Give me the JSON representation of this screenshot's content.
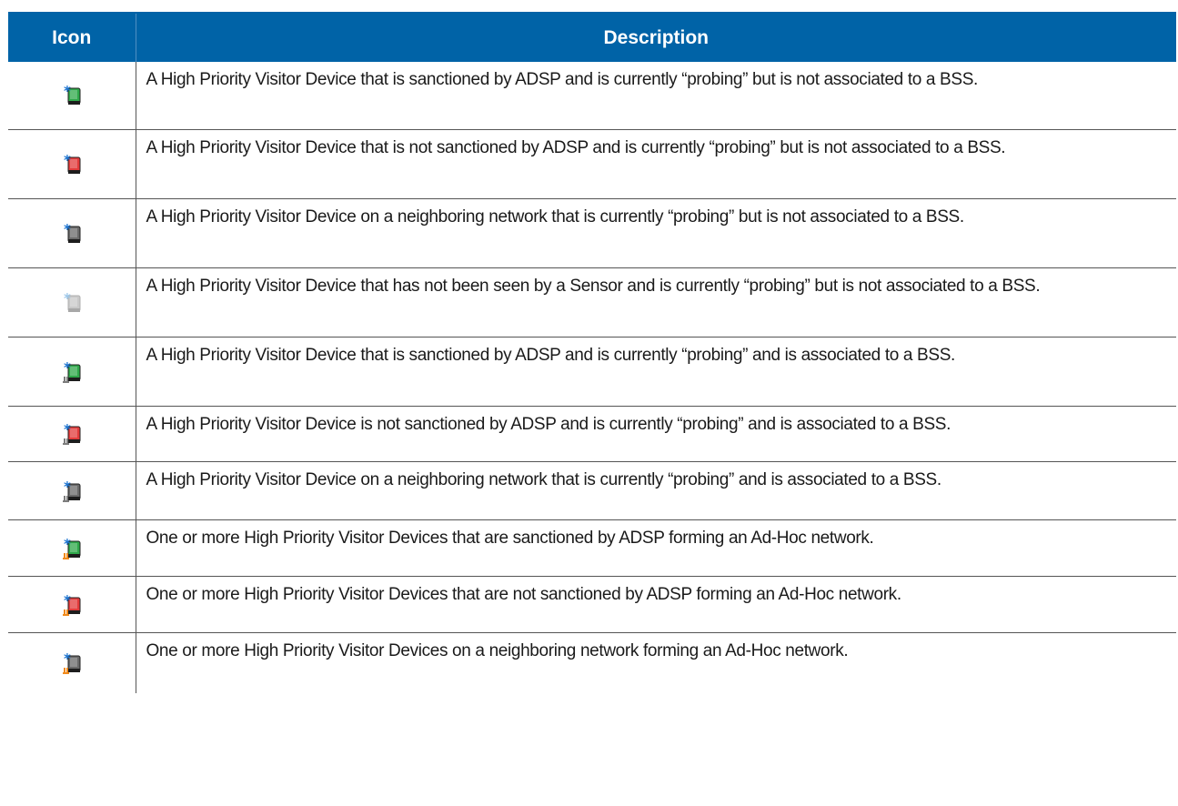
{
  "table": {
    "header": {
      "icon": "Icon",
      "description": "Description"
    },
    "rows": [
      {
        "icon": "visitor-sanctioned-probing-icon",
        "color": "#2fa84a",
        "base": "none",
        "description": "A High Priority Visitor Device that is sanctioned by ADSP and is currently “probing” but is not associated to a BSS."
      },
      {
        "icon": "visitor-unsanctioned-probing-icon",
        "color": "#e23b3b",
        "base": "none",
        "description": "A High Priority Visitor Device that is not sanctioned by ADSP and is currently “probing” but is not associated to a BSS."
      },
      {
        "icon": "visitor-neighbor-probing-icon",
        "color": "#6a6a6a",
        "base": "none",
        "description": "A High Priority Visitor Device on a neighboring network that is currently “probing” but is not associated to a BSS."
      },
      {
        "icon": "visitor-unseen-probing-icon",
        "color": "#c9c9c9",
        "base": "none",
        "description": "A High Priority Visitor Device that has not been seen by a Sensor and is currently “probing” but is not associated to a BSS."
      },
      {
        "icon": "visitor-sanctioned-associated-icon",
        "color": "#2fa84a",
        "base": "gray",
        "description": "A High Priority Visitor Device that is sanctioned by ADSP and is currently “probing” and is associated to a BSS."
      },
      {
        "icon": "visitor-unsanctioned-associated-icon",
        "color": "#e23b3b",
        "base": "gray",
        "description": "A High Priority Visitor Device is not sanctioned by ADSP and is currently “probing” and is associated to a BSS."
      },
      {
        "icon": "visitor-neighbor-associated-icon",
        "color": "#6a6a6a",
        "base": "gray",
        "description": "A High Priority Visitor Device on a neighboring network that is currently “probing” and is associated to a BSS."
      },
      {
        "icon": "visitor-sanctioned-adhoc-icon",
        "color": "#2fa84a",
        "base": "orange",
        "description": "One or more High Priority Visitor Devices that are sanctioned by ADSP forming an Ad-Hoc network."
      },
      {
        "icon": "visitor-unsanctioned-adhoc-icon",
        "color": "#e23b3b",
        "base": "orange",
        "description": "One or more High Priority Visitor Devices that are not sanctioned by ADSP forming an Ad-Hoc network."
      },
      {
        "icon": "visitor-neighbor-adhoc-icon",
        "color": "#6a6a6a",
        "base": "orange",
        "description": "One or more High Priority Visitor Devices on a neighboring network forming an Ad-Hoc network."
      }
    ]
  }
}
